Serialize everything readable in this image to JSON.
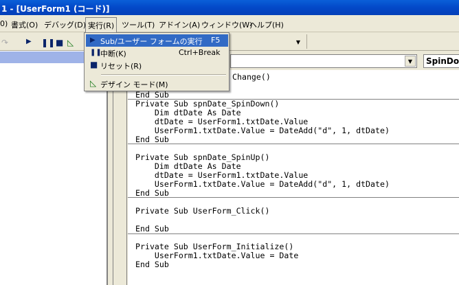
{
  "title": "1 - [UserForm1 (コード)]",
  "menubar": [
    "書式(O)",
    "デバッグ(D)",
    "実行(R)",
    "ツール(T)",
    "アドイン(A)",
    "ウィンドウ(W)",
    "ヘルプ(H)"
  ],
  "menubar_prefix": "0)",
  "toolbar": {
    "run": "run-icon",
    "break": "pause-icon",
    "reset": "stop-icon",
    "design": "design-mode-icon"
  },
  "object_combo": "",
  "procedure_combo": "SpinDown",
  "run_menu": {
    "items": [
      {
        "label": "Sub/ユーザー フォームの実行",
        "shortcut": "F5",
        "icon": "run-icon",
        "highlighted": true
      },
      {
        "label": "中断(K)",
        "shortcut": "Ctrl+Break",
        "icon": "pause-icon"
      },
      {
        "label": "リセット(R)",
        "shortcut": "",
        "icon": "stop-icon"
      },
      {
        "label": "デザイン モード(M)",
        "shortcut": "",
        "icon": "design-mode-icon"
      }
    ]
  },
  "code": [
    "Change()",
    "",
    "End Sub",
    "Private Sub spnDate_SpinDown()",
    "    Dim dtDate As Date",
    "    dtDate = UserForm1.txtDate.Value",
    "    UserForm1.txtDate.Value = DateAdd(\"d\", 1, dtDate)",
    "End Sub",
    "",
    "Private Sub spnDate_SpinUp()",
    "    Dim dtDate As Date",
    "    dtDate = UserForm1.txtDate.Value",
    "    UserForm1.txtDate.Value = DateAdd(\"d\", 1, dtDate)",
    "End Sub",
    "",
    "Private Sub UserForm_Click()",
    "",
    "End Sub",
    "",
    "Private Sub UserForm_Initialize()",
    "    UserForm1.txtDate.Value = Date",
    "End Sub"
  ]
}
